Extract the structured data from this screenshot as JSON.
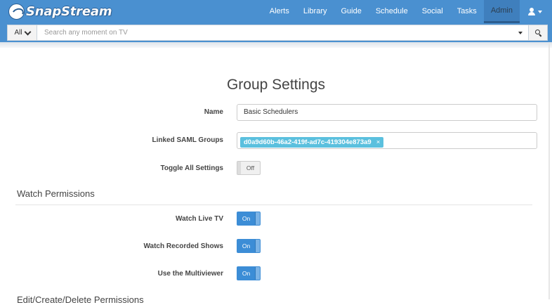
{
  "app": {
    "logo_text": "SnapStream"
  },
  "nav": {
    "items": [
      {
        "label": "Alerts",
        "active": false
      },
      {
        "label": "Library",
        "active": false
      },
      {
        "label": "Guide",
        "active": false
      },
      {
        "label": "Schedule",
        "active": false
      },
      {
        "label": "Social",
        "active": false
      },
      {
        "label": "Tasks",
        "active": false
      },
      {
        "label": "Admin",
        "active": true
      }
    ]
  },
  "search": {
    "scope_label": "All",
    "placeholder": "Search any moment on TV",
    "value": ""
  },
  "page": {
    "title": "Group Settings"
  },
  "form": {
    "name_label": "Name",
    "name_value": "Basic Schedulers",
    "saml_label": "Linked SAML Groups",
    "saml_tags": [
      "d0a9d60b-46a2-419f-ad7c-419304e873a9"
    ],
    "tag_remove_glyph": "×",
    "toggle_all_label": "Toggle All Settings",
    "toggle_all_state": "Off"
  },
  "sections": {
    "watch": {
      "title": "Watch Permissions",
      "settings": [
        {
          "label": "Watch Live TV",
          "state": "On"
        },
        {
          "label": "Watch Recorded Shows",
          "state": "On"
        },
        {
          "label": "Use the Multiviewer",
          "state": "On"
        }
      ]
    },
    "edit": {
      "title": "Edit/Create/Delete Permissions"
    }
  },
  "colors": {
    "navbar": "#4a90d0",
    "toggle_on": "#3c8dd6",
    "tag": "#5bc0de"
  }
}
